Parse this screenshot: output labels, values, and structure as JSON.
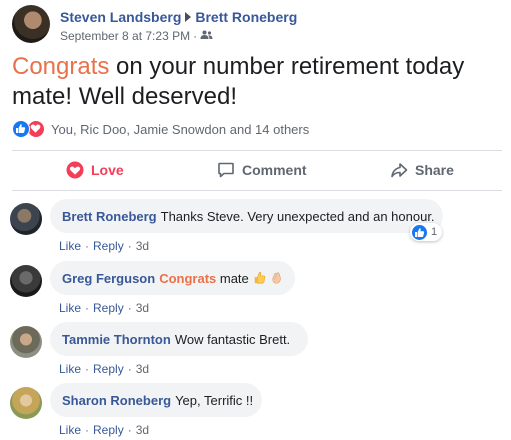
{
  "post": {
    "author": "Steven Landsberg",
    "recipient": "Brett Roneberg",
    "timestamp": "September 8 at 7:23 PM",
    "privacy_icon": "friends-icon",
    "text_highlight": "Congrats",
    "text_rest": " on your number retirement today mate! Well deserved!",
    "reactions_summary": "You, Ric Doo, Jamie Snowdon and 14 others",
    "reaction_icons": [
      "like-icon",
      "love-icon"
    ]
  },
  "actions": {
    "love_label": "Love",
    "comment_label": "Comment",
    "share_label": "Share"
  },
  "comments": [
    {
      "name": "Brett Roneberg",
      "text": "Thanks Steve. Very unexpected and an honour.",
      "like_label": "Like",
      "reply_label": "Reply",
      "time": "3d",
      "reaction_count": "1"
    },
    {
      "name": "Greg Ferguson",
      "text_highlight": "Congrats",
      "text_rest": " mate",
      "emoji": [
        "thumbs-up-emoji",
        "clapping-hands-emoji"
      ],
      "like_label": "Like",
      "reply_label": "Reply",
      "time": "3d"
    },
    {
      "name": "Tammie Thornton",
      "text": "Wow fantastic Brett.",
      "like_label": "Like",
      "reply_label": "Reply",
      "time": "3d"
    },
    {
      "name": "Sharon Roneberg",
      "text": "Yep, Terrific !!",
      "like_label": "Like",
      "reply_label": "Reply",
      "time": "3d"
    }
  ],
  "colors": {
    "link_blue": "#385898",
    "highlight_orange": "#e9714a",
    "love_red": "#f33e58",
    "like_blue": "#1877f2",
    "meta_gray": "#606770",
    "bubble_bg": "#f2f3f5"
  }
}
